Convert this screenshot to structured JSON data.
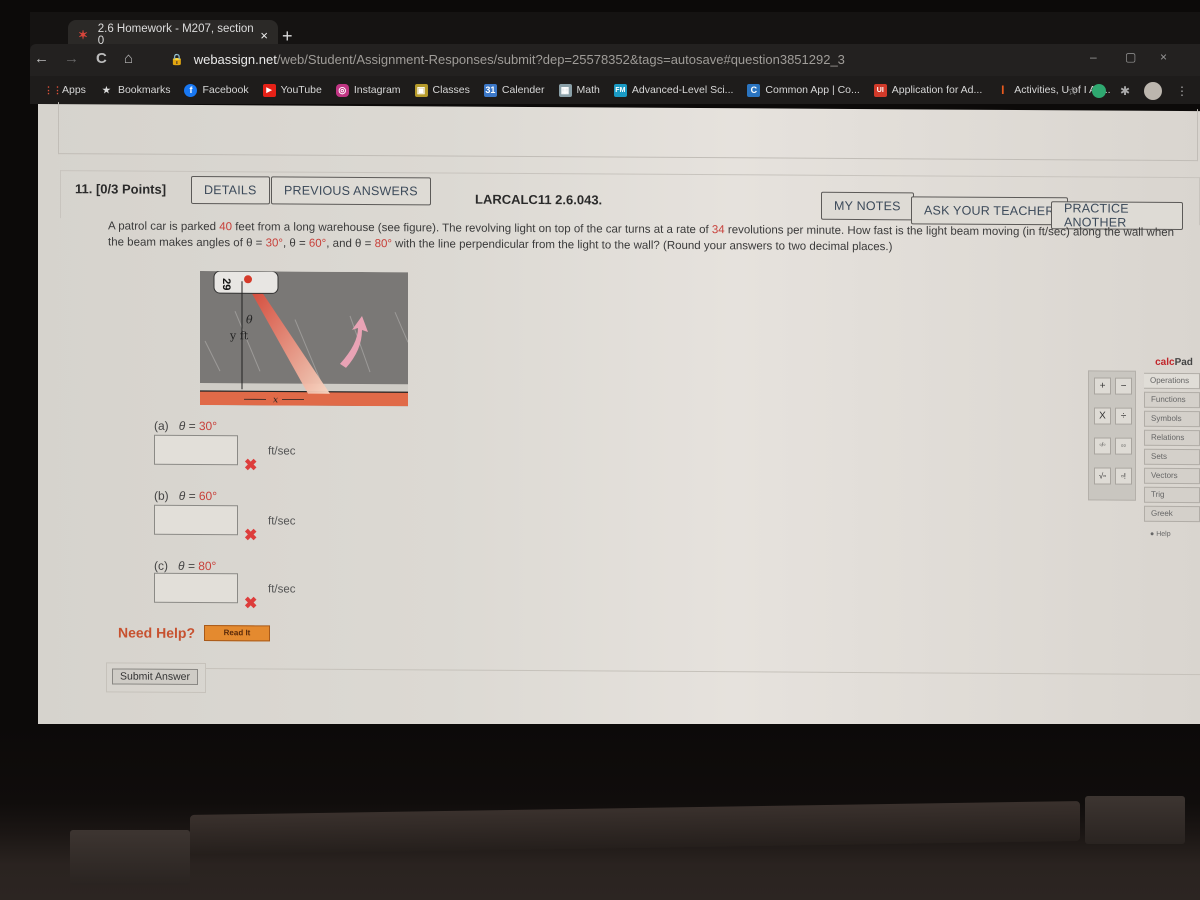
{
  "browser": {
    "tab_title": "2.6 Homework - M207, section 0",
    "tab_close": "×",
    "new_tab": "+",
    "url_host": "webassign.net",
    "url_path": "/web/Student/Assignment-Responses/submit?dep=25578352&tags=autosave#question3851292_3",
    "nav": {
      "back": "←",
      "forward": "→",
      "reload": "C",
      "home": "⌂"
    },
    "window_controls": {
      "minimize": "–",
      "maximize": "▢",
      "close": "×"
    },
    "bookmarks": [
      {
        "label": "Apps",
        "icon": "apps-grid-icon",
        "color": "#e0523a"
      },
      {
        "label": "Bookmarks",
        "icon": "star-icon",
        "color": "#d0d0d0"
      },
      {
        "label": "Facebook",
        "icon": "facebook-icon",
        "color": "#1877f2"
      },
      {
        "label": "YouTube",
        "icon": "youtube-icon",
        "color": "#e62117"
      },
      {
        "label": "Instagram",
        "icon": "instagram-icon",
        "color": "#c13584"
      },
      {
        "label": "Classes",
        "icon": "google-classroom-icon",
        "color": "#b59a2a"
      },
      {
        "label": "Calender",
        "icon": "calendar-icon",
        "color": "#3c78c8"
      },
      {
        "label": "Math",
        "icon": "math-icon",
        "color": "#8aa0a8"
      },
      {
        "label": "Advanced-Level Sci...",
        "icon": "fm-icon",
        "color": "#1a9ac4"
      },
      {
        "label": "Common App | Co...",
        "icon": "common-app-icon",
        "color": "#2a74c0"
      },
      {
        "label": "Application for Ad...",
        "icon": "application-icon",
        "color": "#d13a2a"
      },
      {
        "label": "Activities, U of I Ad...",
        "icon": "uofi-icon",
        "color": "#e85a1e"
      }
    ]
  },
  "question": {
    "number_points": "11.  [0/3 Points]",
    "details_label": "DETAILS",
    "previous_answers_label": "PREVIOUS ANSWERS",
    "code": "LARCALC11 2.6.043.",
    "my_notes_label": "MY NOTES",
    "ask_teacher_label": "ASK YOUR TEACHER",
    "practice_another_label": "PRACTICE ANOTHER",
    "text": {
      "p1": "A patrol car is parked ",
      "distance": "40",
      "p2": " feet from a long warehouse (see figure). The revolving light on top of the car turns at a rate of ",
      "rate": "34",
      "p3": " revolutions per minute. How fast is the light beam moving (in ft/sec) along the wall when the beam makes angles of θ = ",
      "a1": "30°",
      "p4": ", θ = ",
      "a2": "60°",
      "p5": ", and θ = ",
      "a3": "80°",
      "p6": " with the line perpendicular from the light to the wall? (Round your answers to two decimal places.)"
    },
    "figure": {
      "car_number": "29",
      "theta": "θ",
      "y_label": "y ft",
      "x_label": "x"
    },
    "parts": [
      {
        "label": "(a)",
        "eq": "θ = ",
        "angle": "30°",
        "value": "",
        "unit": "ft/sec",
        "status": "incorrect",
        "mark": "✖"
      },
      {
        "label": "(b)",
        "eq": "θ = ",
        "angle": "60°",
        "value": "",
        "unit": "ft/sec",
        "status": "incorrect",
        "mark": "✖"
      },
      {
        "label": "(c)",
        "eq": "θ = ",
        "angle": "80°",
        "value": "",
        "unit": "ft/sec",
        "status": "incorrect",
        "mark": "✖"
      }
    ],
    "need_help": "Need Help?",
    "read_it": "Read It",
    "submit": "Submit Answer"
  },
  "calcpad": {
    "title_a": "calc",
    "title_b": "Pad",
    "keys": [
      "+",
      "−",
      "X",
      "÷",
      "▫/▫",
      "▫▫",
      "√▫",
      "▫!"
    ],
    "tabs": [
      "Operations",
      "Functions",
      "Symbols",
      "Relations",
      "Sets",
      "Vectors",
      "Trig",
      "Greek"
    ],
    "help": "Help"
  }
}
